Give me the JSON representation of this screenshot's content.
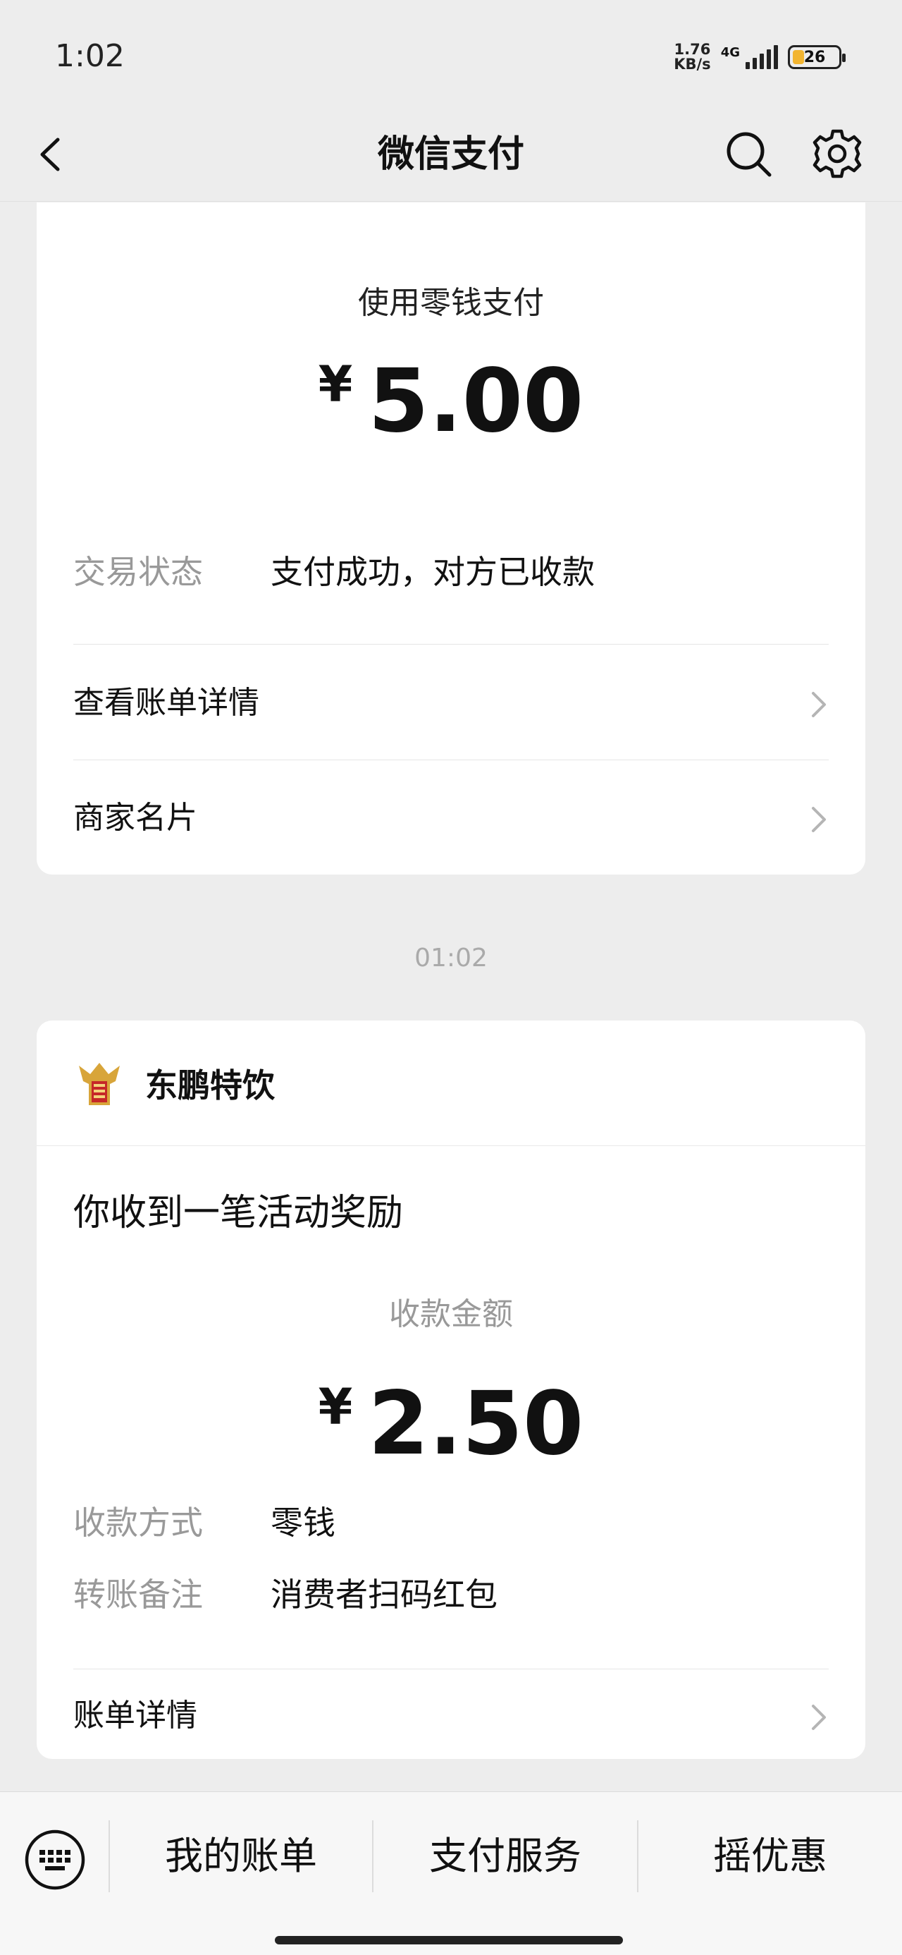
{
  "status_bar": {
    "time": "1:02",
    "net_speed_value": "1.76",
    "net_speed_unit": "KB/s",
    "network_type": "4G",
    "battery": "26"
  },
  "nav": {
    "title": "微信支付",
    "back_icon": "chevron-left-icon",
    "search_icon": "search-icon",
    "settings_icon": "gear-icon"
  },
  "payment_card": {
    "pay_method_label": "使用零钱支付",
    "currency_symbol": "¥",
    "amount": "5.00",
    "status_key": "交易状态",
    "status_value": "支付成功，对方已收款",
    "bill_detail_link": "查看账单详情",
    "merchant_card_link": "商家名片"
  },
  "timestamp": "01:02",
  "reward_card": {
    "merchant_name": "东鹏特饮",
    "title": "你收到一笔活动奖励",
    "receive_label": "收款金额",
    "currency_symbol": "¥",
    "amount": "2.50",
    "method_key": "收款方式",
    "method_value": "零钱",
    "note_key": "转账备注",
    "note_value": "消费者扫码红包",
    "bill_detail_link": "账单详情"
  },
  "bottom_bar": {
    "keyboard_icon": "keyboard-icon",
    "items": [
      {
        "label": "我的账单"
      },
      {
        "label": "支付服务"
      },
      {
        "label": "摇优惠"
      }
    ]
  },
  "colors": {
    "background": "#ededed",
    "card": "#ffffff",
    "muted_text": "#999999",
    "battery_fill": "#f2b531"
  }
}
